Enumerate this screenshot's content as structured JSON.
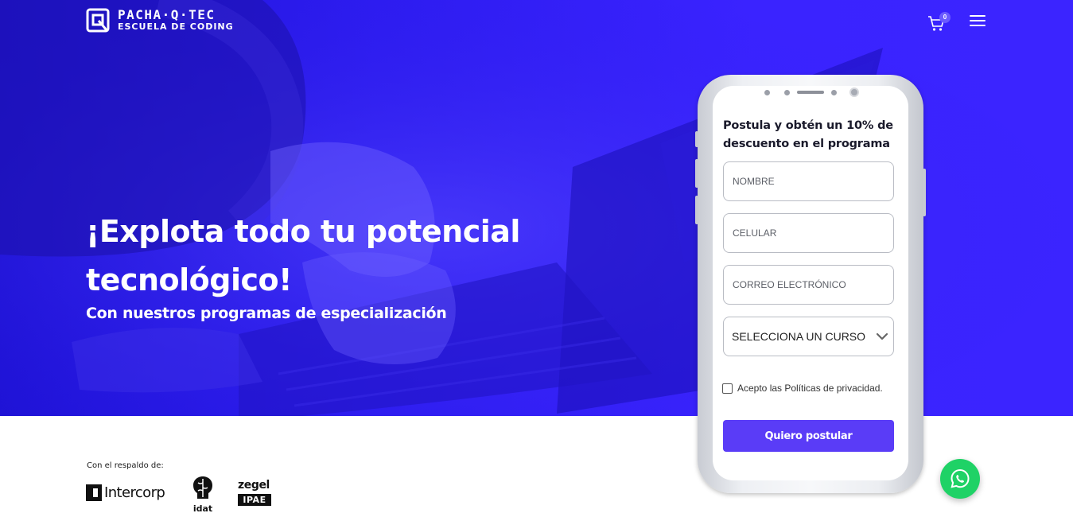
{
  "header": {
    "logo_name": "PACHA·Q·TEC",
    "logo_subtitle": "ESCUELA DE CODING",
    "cart_icon": "cart-icon",
    "cart_count": "0",
    "menu_icon": "hamburger-menu-icon"
  },
  "hero": {
    "title_line1": "¡Explota todo tu potencial",
    "title_line2": "tecnológico!",
    "subtitle": "Con nuestros programas de especialización"
  },
  "form": {
    "title": "Postula y obtén un 10% de descuento en el programa",
    "name_placeholder": "NOMBRE",
    "phone_placeholder": "CELULAR",
    "email_placeholder": "CORREO ELECTRÓNICO",
    "course_select_value": "SELECCIONA UN CURSO",
    "privacy_label": "Acepto las Políticas de privacidad.",
    "submit_label": "Quiero postular"
  },
  "backers": {
    "label": "Con el respaldo de:",
    "logos": [
      "Intercorp",
      "idat",
      "zegel",
      "IPAE"
    ]
  },
  "floating": {
    "whatsapp_icon": "whatsapp-icon"
  },
  "colors": {
    "hero_blue": "#3322ff",
    "button_purple": "#5a3cf7",
    "whatsapp_green": "#1fd266"
  }
}
